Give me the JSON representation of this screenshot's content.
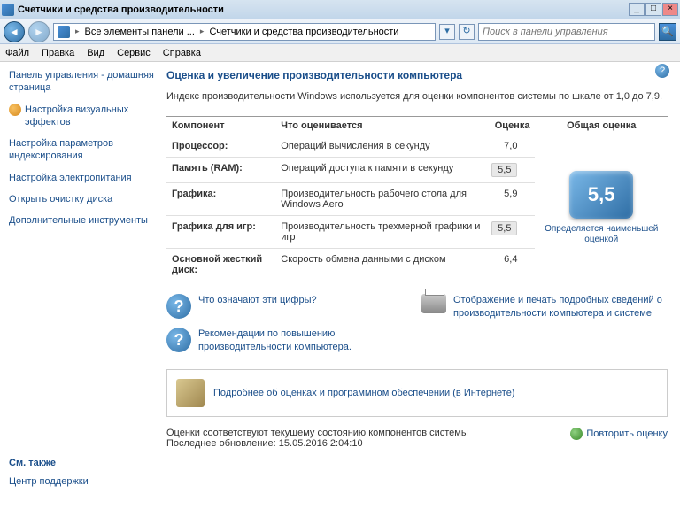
{
  "titlebar": {
    "title": "Счетчики и средства производительности"
  },
  "nav": {
    "breadcrumb1": "Все элементы панели ...",
    "breadcrumb2": "Счетчики и средства производительности",
    "search_placeholder": "Поиск в панели управления"
  },
  "menu": {
    "file": "Файл",
    "edit": "Правка",
    "view": "Вид",
    "service": "Сервис",
    "help": "Справка"
  },
  "sidebar": {
    "home": "Панель управления - домашняя страница",
    "visual": "Настройка визуальных эффектов",
    "indexing": "Настройка параметров индексирования",
    "power": "Настройка электропитания",
    "cleanup": "Открыть очистку диска",
    "tools": "Дополнительные инструменты",
    "seealso_head": "См. также",
    "support": "Центр поддержки"
  },
  "main": {
    "heading": "Оценка и увеличение производительности компьютера",
    "desc": "Индекс производительности Windows используется для оценки компонентов системы по шкале от 1,0 до 7,9.",
    "th_component": "Компонент",
    "th_what": "Что оценивается",
    "th_score": "Оценка",
    "th_base": "Общая оценка",
    "rows": [
      {
        "comp": "Процессор:",
        "what": "Операций вычисления в секунду",
        "score": "7,0"
      },
      {
        "comp": "Память (RAM):",
        "what": "Операций доступа к памяти в секунду",
        "score": "5,5"
      },
      {
        "comp": "Графика:",
        "what": "Производительность рабочего стола для Windows Aero",
        "score": "5,9"
      },
      {
        "comp": "Графика для игр:",
        "what": "Производительность трехмерной графики и игр",
        "score": "5,5"
      },
      {
        "comp": "Основной жесткий диск:",
        "what": "Скорость обмена данными с диском",
        "score": "6,4"
      }
    ],
    "base_score": "5,5",
    "base_label": "Определяется наименьшей оценкой",
    "link_what": "Что означают эти цифры?",
    "link_rec": "Рекомендации по повышению производительности компьютера.",
    "link_print": "Отображение и печать подробных сведений о производительности компьютера и системе",
    "link_learn": "Подробнее об оценках и программном обеспечении (в Интернете)",
    "status1": "Оценки соответствуют текущему состоянию компонентов системы",
    "status2": "Последнее обновление: 15.05.2016 2:04:10",
    "rerun": "Повторить оценку"
  }
}
